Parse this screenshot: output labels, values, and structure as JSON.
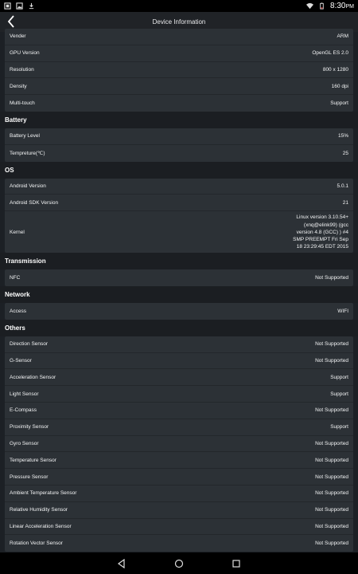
{
  "status_bar": {
    "time": "8:30",
    "am_pm": "PM"
  },
  "app_bar": {
    "title": "Device Information"
  },
  "sections": [
    {
      "header": "",
      "rows": [
        {
          "label": "Vender",
          "value": "ARM"
        },
        {
          "label": "GPU Version",
          "value": "OpenGL ES 2.0"
        },
        {
          "label": "Resolution",
          "value": "800 x 1280"
        },
        {
          "label": "Density",
          "value": "160 dpi"
        },
        {
          "label": "Multi-touch",
          "value": "Support"
        }
      ]
    },
    {
      "header": "Battery",
      "rows": [
        {
          "label": "Battery Level",
          "value": "15%"
        },
        {
          "label": "Tempreture(℃)",
          "value": "25"
        }
      ]
    },
    {
      "header": "OS",
      "rows": [
        {
          "label": "Android Version",
          "value": "5.0.1"
        },
        {
          "label": "Android SDK Version",
          "value": "21"
        },
        {
          "label": "Kernel",
          "value": "Linux version 3.10.54+\n(xnq@elink99) (gcc\nversion 4.8 (GCC) ) #4\nSMP PREEMPT Fri Sep\n18 23:29:45 EDT 2015"
        }
      ]
    },
    {
      "header": "Transmission",
      "rows": [
        {
          "label": "NFC",
          "value": "Not Supported"
        }
      ]
    },
    {
      "header": "Network",
      "rows": [
        {
          "label": "Access",
          "value": "WIFI"
        }
      ]
    },
    {
      "header": "Others",
      "rows": [
        {
          "label": "Direction Sensor",
          "value": "Not Supported"
        },
        {
          "label": "G-Sensor",
          "value": "Not Supported"
        },
        {
          "label": "Acceleration Sensor",
          "value": "Support"
        },
        {
          "label": "Light Sensor",
          "value": "Support"
        },
        {
          "label": "E-Compass",
          "value": "Not Supported"
        },
        {
          "label": "Proximity Sensor",
          "value": "Support"
        },
        {
          "label": "Gyro Sensor",
          "value": "Not Supported"
        },
        {
          "label": "Temperature Sensor",
          "value": "Not Supported"
        },
        {
          "label": "Pressure Sensor",
          "value": "Not Supported"
        },
        {
          "label": "Ambient Temperature Sensor",
          "value": "Not Supported"
        },
        {
          "label": "Relative Humidity Sensor",
          "value": "Not Supported"
        },
        {
          "label": "Linear Acceleration Sensor",
          "value": "Not Supported"
        },
        {
          "label": "Rotation Vector Sensor",
          "value": "Not Supported"
        }
      ]
    }
  ],
  "nav_bar": {
    "buttons": [
      "back",
      "home",
      "recents"
    ]
  }
}
